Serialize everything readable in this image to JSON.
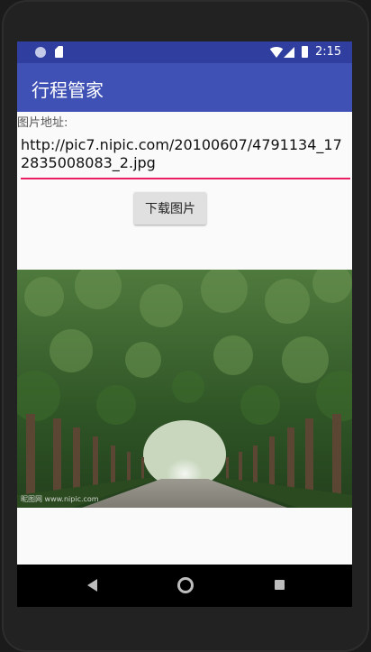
{
  "status_bar": {
    "time": "2:15"
  },
  "app_bar": {
    "title": "行程管家"
  },
  "form": {
    "label": "图片地址:",
    "url_value": "http://pic7.nipic.com/20100607/4791134_172835008083_2.jpg",
    "download_label": "下载图片"
  },
  "image": {
    "watermark": "昵图网 www.nipic.com"
  },
  "colors": {
    "primary": "#3f51b5",
    "primary_dark": "#303f9f",
    "accent": "#e91e63"
  },
  "icons": {
    "status": [
      "notification-dot-icon",
      "sd-card-icon",
      "wifi-icon",
      "signal-icon",
      "battery-icon"
    ],
    "nav": [
      "back-icon",
      "home-icon",
      "recents-icon"
    ]
  }
}
